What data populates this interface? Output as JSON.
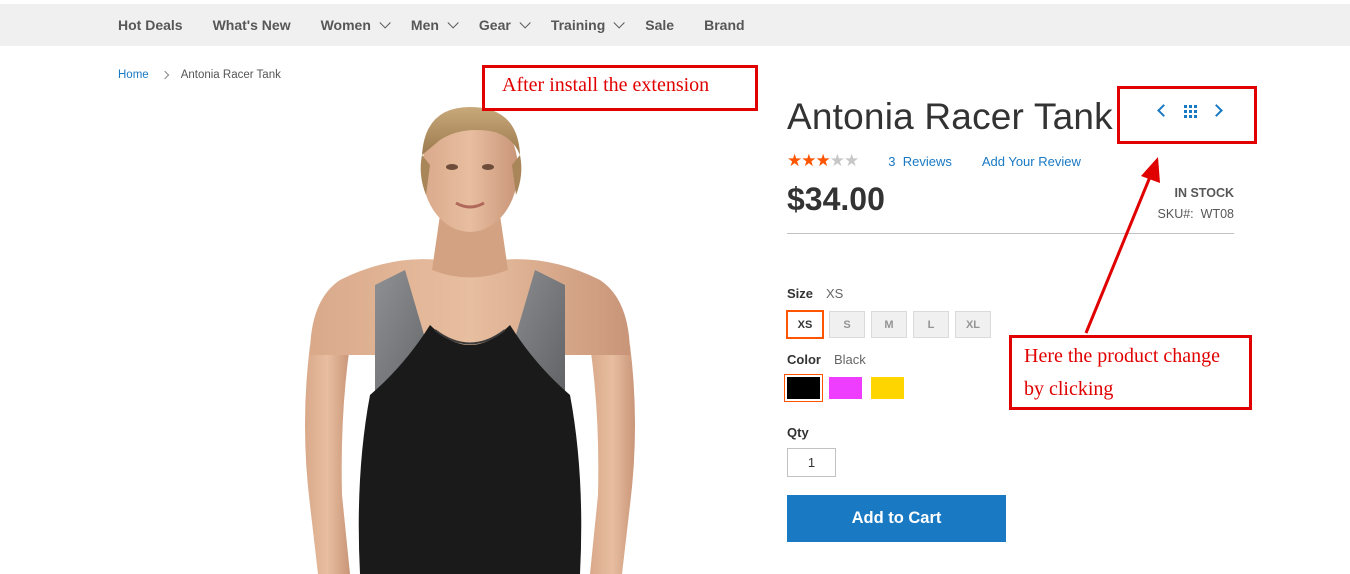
{
  "nav": {
    "items": [
      {
        "label": "Hot Deals",
        "has_submenu": false
      },
      {
        "label": "What's New",
        "has_submenu": false
      },
      {
        "label": "Women",
        "has_submenu": true
      },
      {
        "label": "Men",
        "has_submenu": true
      },
      {
        "label": "Gear",
        "has_submenu": true
      },
      {
        "label": "Training",
        "has_submenu": true
      },
      {
        "label": "Sale",
        "has_submenu": false
      },
      {
        "label": "Brand",
        "has_submenu": false
      }
    ]
  },
  "breadcrumb": {
    "home": "Home",
    "current": "Antonia Racer Tank"
  },
  "annotations": {
    "top": "After install the extension",
    "right_line1": "Here the product change",
    "right_line2": "by clicking",
    "color": "#e00000"
  },
  "product": {
    "title": "Antonia Racer Tank",
    "rating": {
      "stars_on": 3,
      "stars_total": 5
    },
    "reviews_count": "3",
    "reviews_label": "Reviews",
    "add_review": "Add Your Review",
    "price": "$34.00",
    "stock": "IN STOCK",
    "sku_label": "SKU#:",
    "sku": "WT08",
    "size_label": "Size",
    "size_selected": "XS",
    "sizes": [
      "XS",
      "S",
      "M",
      "L",
      "XL"
    ],
    "color_label": "Color",
    "color_selected": "Black",
    "colors": [
      {
        "name": "black",
        "hex": "#000000"
      },
      {
        "name": "purple",
        "hex": "#ef3dff"
      },
      {
        "name": "yellow",
        "hex": "#ffd500"
      }
    ],
    "qty_label": "Qty",
    "qty": "1",
    "add_to_cart": "Add to Cart"
  },
  "switcher": {
    "prev_icon": "chevron-left-icon",
    "grid_icon": "grid-icon",
    "next_icon": "chevron-right-icon"
  },
  "theme": {
    "accent": "#1979c3",
    "star": "#ff5501"
  }
}
